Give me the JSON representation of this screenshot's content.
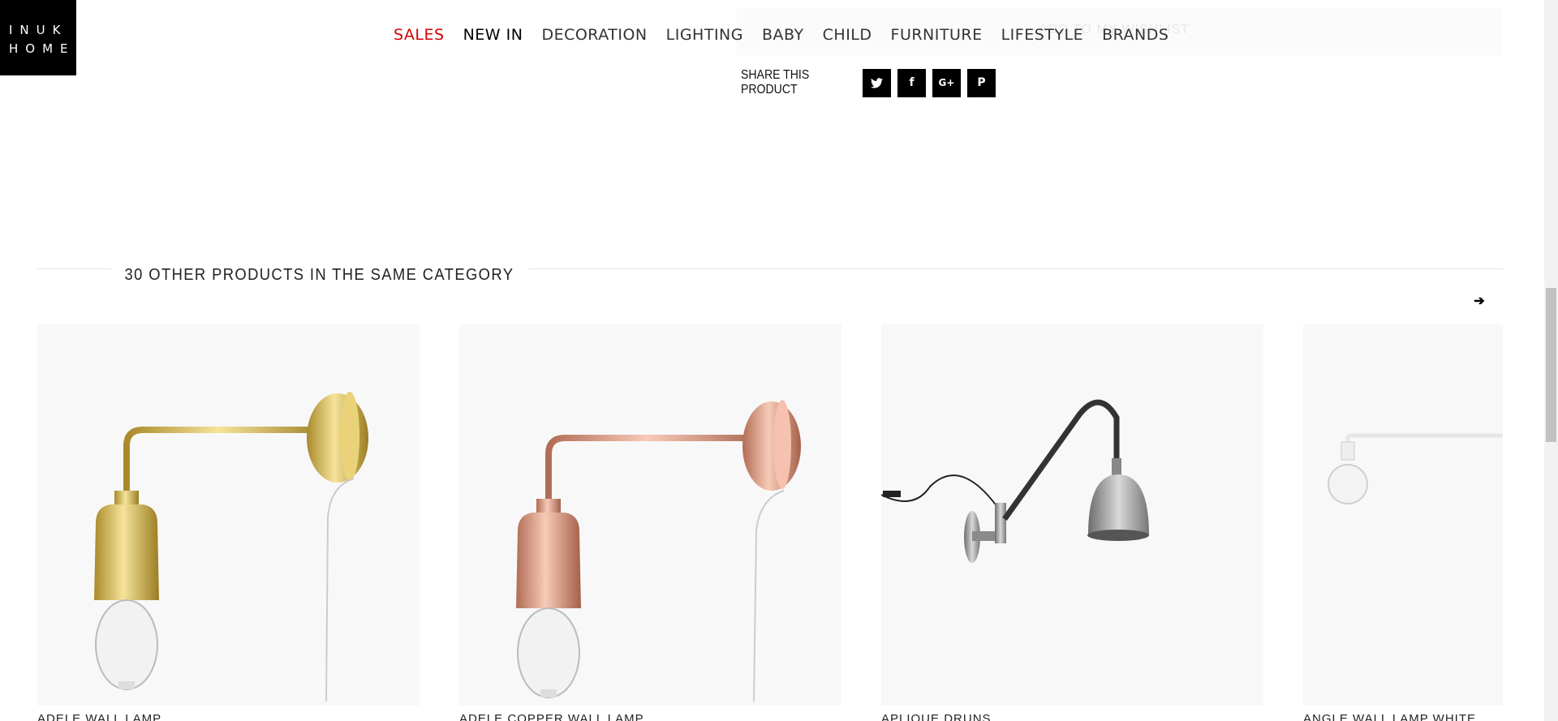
{
  "brand": {
    "line1": "INUK",
    "line2": "HOME"
  },
  "nav": {
    "items": [
      "SALES",
      "NEW IN",
      "DECORATION",
      "LIGHTING",
      "BABY",
      "CHILD",
      "FURNITURE",
      "LIFESTYLE",
      "BRANDS"
    ],
    "highlight_color": "#d40000"
  },
  "wishlist_text": "ADD TO MY WISHLIST",
  "share": {
    "label": "SHARE THIS PRODUCT",
    "buttons": [
      {
        "icon": "twitter-icon",
        "glyph": "🐦"
      },
      {
        "icon": "facebook-icon",
        "glyph": "f"
      },
      {
        "icon": "google-plus-icon",
        "glyph": "G+"
      },
      {
        "icon": "pinterest-icon",
        "glyph": "P"
      }
    ]
  },
  "related": {
    "title": "30 OTHER PRODUCTS IN THE SAME CATEGORY",
    "next_icon": "arrow-right-icon",
    "next_glyph": "➔",
    "products": [
      {
        "name": "ADELE WALL LAMP",
        "finish": "brass"
      },
      {
        "name": "ADELE COPPER WALL LAMP",
        "finish": "copper"
      },
      {
        "name": "APLIQUE DRUNS",
        "finish": "steel"
      },
      {
        "name": "ANGLE WALL LAMP WHITE",
        "finish": "white"
      }
    ]
  }
}
